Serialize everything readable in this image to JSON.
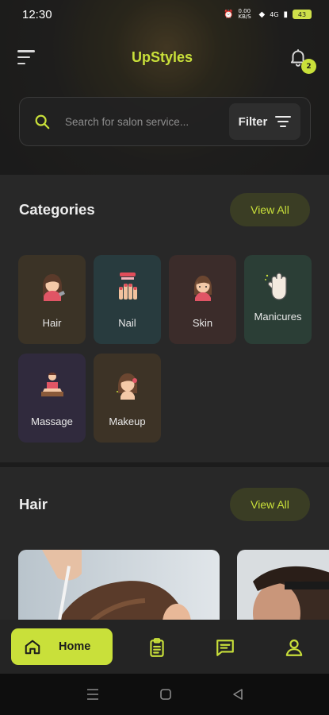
{
  "status": {
    "time": "12:30",
    "data_speed": "0.00 KB/S",
    "network": "4G",
    "battery": "43"
  },
  "header": {
    "app_title": "UpStyles",
    "notification_count": "2"
  },
  "search": {
    "placeholder": "Search for salon service...",
    "filter_label": "Filter"
  },
  "categories": {
    "title": "Categories",
    "view_all": "View All",
    "items": [
      {
        "label": "Hair",
        "color": "#3b3326",
        "icon": "hair-woman-icon"
      },
      {
        "label": "Nail",
        "color": "#283b3e",
        "icon": "nail-polish-icon"
      },
      {
        "label": "Skin",
        "color": "#3b2c2a",
        "icon": "skin-woman-icon"
      },
      {
        "label": "Manicures",
        "color": "#2b3e36",
        "icon": "manicure-hand-icon"
      },
      {
        "label": "Massage",
        "color": "#302a3d",
        "icon": "massage-icon"
      },
      {
        "label": "Makeup",
        "color": "#3d3326",
        "icon": "makeup-woman-icon"
      }
    ]
  },
  "hair_section": {
    "title": "Hair",
    "view_all": "View All"
  },
  "bottom_nav": {
    "home_label": "Home",
    "accent": "#c9e03a"
  }
}
